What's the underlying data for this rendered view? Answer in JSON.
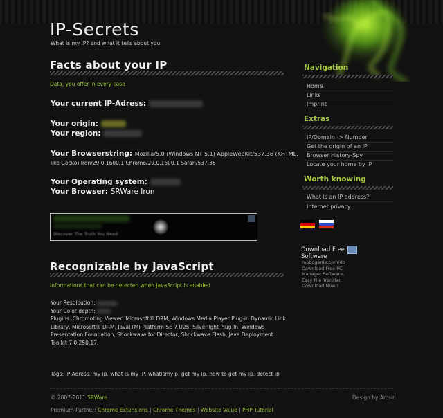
{
  "header": {
    "title": "IP-Secrets",
    "tagline": "What is my IP? and what it tells about you"
  },
  "facts": {
    "heading": "Facts about your IP",
    "note": "Data, you offer in every case",
    "ip_label": "Your current IP-Adress:",
    "origin_label": "Your origin:",
    "region_label": "Your region:",
    "browserstring_label": "Your Browserstring:",
    "browserstring_value_line1": "Mozilla/5.0 (Windows NT 5.1) AppleWebKit/537.36 (KHTML,",
    "browserstring_value_line2": "like Gecko) Iron/29.0.1600.1 Chrome/29.0.1600.1 Safari/537.36",
    "os_label": "Your Operating system:",
    "browser_label": "Your Browser:",
    "browser_value": "SRWare Iron"
  },
  "ad_banner": {
    "text": "Discover The Truth You Need"
  },
  "js_section": {
    "heading": "Recognizable by JavaScript",
    "note": "Informations that can be detected when JavaScript is enabled",
    "resolution_label": "Your Resoloution:",
    "color_depth_label": "Your Color depth:",
    "plugins": "Plugins: Chromoting Viewer, Microsoft® DRM, Windows Media Player Plug-in Dynamic Link Library, Microsoft® DRM, Java(TM) Platform SE 7 U25, Silverlight Plug-In, Windows Presentation Foundation, Shockwave for Director, Shockwave Flash, Java Deployment Toolkit 7.0.250.17,"
  },
  "tags": "Tags: IP-Adress, my ip, what is my IP, whatismyip, get my ip, how to get my ip, detect ip",
  "footer": {
    "copyright": "© 2007-2011",
    "brand_link": "SRWare",
    "design": "Design by Arcsin",
    "partner_label": "Premium-Partner:",
    "partner_links": [
      "Chrome Extensions",
      "Chrome Themes",
      "Website Value",
      "PHP Tutorial"
    ],
    "separator": "|"
  },
  "sidebar": {
    "navigation": {
      "heading": "Navigation",
      "items": [
        "Home",
        "Links",
        "Imprint"
      ]
    },
    "extras": {
      "heading": "Extras",
      "items": [
        "IP/Domain -> Number",
        "Get the origin of an IP",
        "Browser History-Spy",
        "Locate your home by IP"
      ]
    },
    "worth_knowing": {
      "heading": "Worth knowing",
      "items": [
        "What is an IP address?",
        "Internet privacy"
      ]
    },
    "languages": [
      "flag-de",
      "flag-ru"
    ],
    "ad": {
      "title": "Download Free Software",
      "source": "mobogenie.com/do",
      "line1": "Download Free PC",
      "line2": "Manager Software.",
      "line3": "Easy File Transfer.",
      "line4": "Download Now !"
    }
  },
  "colors": {
    "background": "#121212",
    "accent_green": "#9bc33a",
    "sidebar_heading": "#a8c84a",
    "text": "#d8d8d8"
  }
}
